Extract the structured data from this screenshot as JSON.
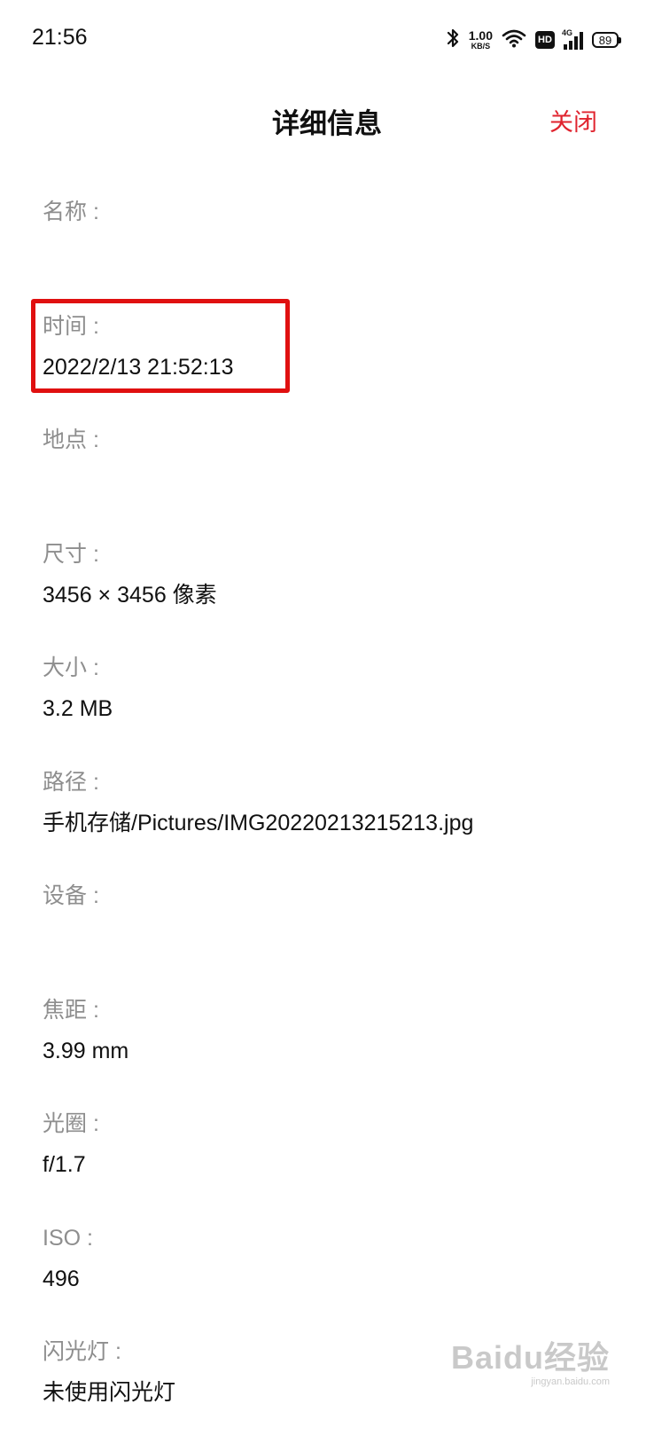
{
  "status_bar": {
    "time": "21:56",
    "net_speed_value": "1.00",
    "net_speed_unit": "KB/S",
    "hd_label": "HD",
    "network_type": "4G",
    "battery_level": "89",
    "icons": [
      "bluetooth-icon",
      "wifi-icon",
      "hd-icon",
      "signal-icon",
      "battery-icon"
    ]
  },
  "header": {
    "title": "详细信息",
    "close_label": "关闭"
  },
  "fields": [
    {
      "label": "名称 :",
      "value": ""
    },
    {
      "label": "时间 :",
      "value": "2022/2/13 21:52:13"
    },
    {
      "label": "地点 :",
      "value": ""
    },
    {
      "label": "尺寸 :",
      "value": "3456 × 3456 像素"
    },
    {
      "label": "大小 :",
      "value": "3.2 MB"
    },
    {
      "label": "路径 :",
      "value": "手机存储/Pictures/IMG20220213215213.jpg"
    },
    {
      "label": "设备 :",
      "value": ""
    },
    {
      "label": "焦距 :",
      "value": "3.99 mm"
    },
    {
      "label": "光圈 :",
      "value": "f/1.7"
    },
    {
      "label": "ISO :",
      "value": "496"
    },
    {
      "label": "闪光灯 :",
      "value": "未使用闪光灯"
    }
  ],
  "watermark": {
    "logo": "Baidu经验",
    "url": "jingyan.baidu.com"
  },
  "colors": {
    "accent": "#e0232e",
    "highlight": "#e01010",
    "label": "#8e8e8e",
    "text": "#111111"
  }
}
